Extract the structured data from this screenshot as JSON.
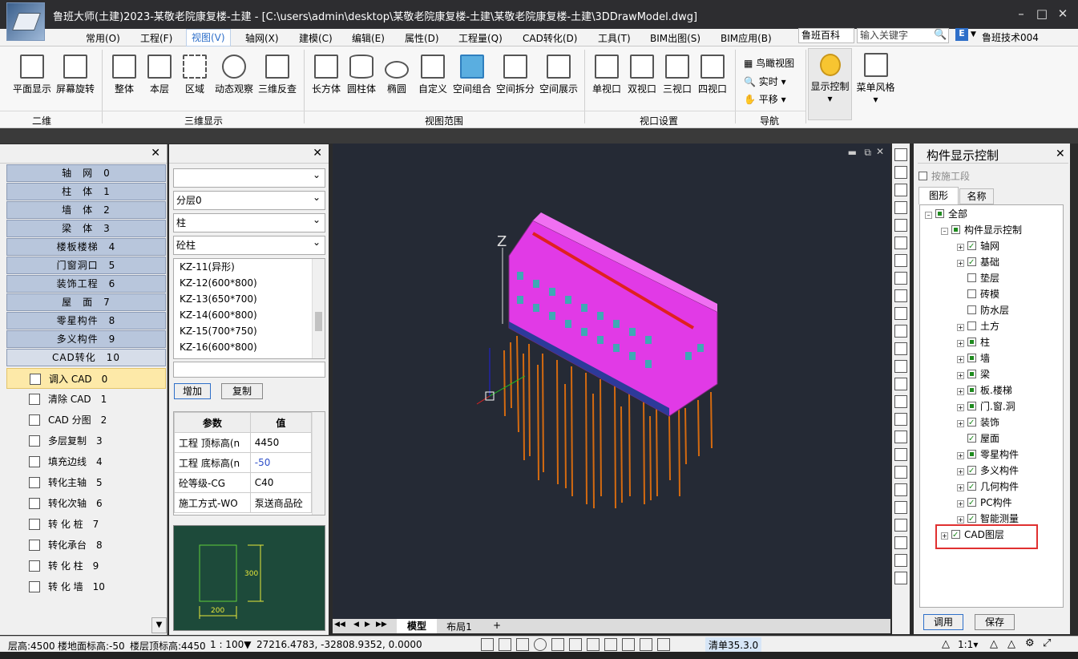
{
  "title": "鲁班大师(土建)2023-某敬老院康复楼-土建 - [C:\\users\\admin\\desktop\\某敬老院康复楼-土建\\某敬老院康复楼-土建\\3DDrawModel.dwg]",
  "menus": [
    "常用(O)",
    "工程(F)",
    "视图(V)",
    "轴网(X)",
    "建模(C)",
    "编辑(E)",
    "属性(D)",
    "工程量(Q)",
    "CAD转化(D)",
    "工具(T)",
    "BIM出图(S)",
    "BIM应用(B)"
  ],
  "search": {
    "source": "鲁班百科",
    "placeholder": "输入关键字"
  },
  "user": "鲁班技术004",
  "ribbon": {
    "b2d": [
      "平面显示",
      "屏幕旋转"
    ],
    "b3d": [
      "整体",
      "本层",
      "区域",
      "动态观察",
      "三维反查"
    ],
    "brange": [
      "长方体",
      "圆柱体",
      "椭圆",
      "自定义",
      "空间组合",
      "空间拆分",
      "空间展示"
    ],
    "bview": [
      "单视口",
      "双视口",
      "三视口",
      "四视口"
    ],
    "nav": [
      "鸟瞰视图",
      "实时",
      "平移"
    ],
    "display": "显示控制",
    "menustyle": "菜单风格",
    "groups": [
      "二维",
      "三维显示",
      "视图范围",
      "视口设置",
      "导航"
    ]
  },
  "categories": [
    "轴　网　0",
    "柱　体　1",
    "墙　体　2",
    "梁　体　3",
    "楼板楼梯　4",
    "门窗洞口　5",
    "装饰工程　6",
    "屋　面　7",
    "零星构件　8",
    "多义构件　9",
    "CAD转化　10"
  ],
  "commands": [
    "调入 CAD　0",
    "清除 CAD　1",
    "CAD 分图　2",
    "多层复制　3",
    "填充边线　4",
    "转化主轴　5",
    "转化次轴　6",
    "转 化 桩　7",
    "转化承台　8",
    "转 化 柱　9",
    "转 化 墙　10"
  ],
  "props": {
    "dd1": "",
    "floor": "分层0",
    "type": "柱",
    "sub": "砼柱"
  },
  "kz": [
    "KZ-11(异形)",
    "KZ-12(600*800)",
    "KZ-13(650*700)",
    "KZ-14(600*800)",
    "KZ-15(700*750)",
    "KZ-16(600*800)"
  ],
  "buttons": {
    "add": "增加",
    "copy": "复制",
    "apply": "调用",
    "save": "保存"
  },
  "param_head": [
    "参数",
    "值"
  ],
  "params": [
    [
      "工程 顶标高(n",
      "4450"
    ],
    [
      "工程 底标高(n",
      "-50"
    ],
    [
      "砼等级-CG",
      "C40"
    ],
    [
      "施工方式-WO",
      "泵送商品砼"
    ]
  ],
  "preview": {
    "w": "200",
    "h": "300"
  },
  "axis_z": "Z",
  "vtabs": {
    "model": "模型",
    "layout": "布局1",
    "plus": "+"
  },
  "rp": {
    "title": "构件显示控制",
    "by_section": "按施工段",
    "tab1": "图形",
    "tab2": "名称"
  },
  "tree": [
    "全部",
    "构件显示控制",
    "轴网",
    "基础",
    "垫层",
    "砖模",
    "防水层",
    "土方",
    "柱",
    "墙",
    "梁",
    "板.楼梯",
    "门.窗.洞",
    "装饰",
    "屋面",
    "零星构件",
    "多义构件",
    "几何构件",
    "PC构件",
    "智能测量",
    "CAD图层"
  ],
  "status": {
    "floor_h": "层高:4500",
    "floor_elev": "楼地面标高:-50",
    "floor_top": "楼层顶标高:4450",
    "scale": "1 : 100▼",
    "coords": "27216.4783, -32808.9352, 0.0000",
    "list": "清单35.3.0",
    "ratio": "1:1▾"
  },
  "colors": {
    "accent": "#2e6fc9",
    "highlight": "#e03030",
    "building": "#e13ae6",
    "piles": "#e07a12"
  }
}
